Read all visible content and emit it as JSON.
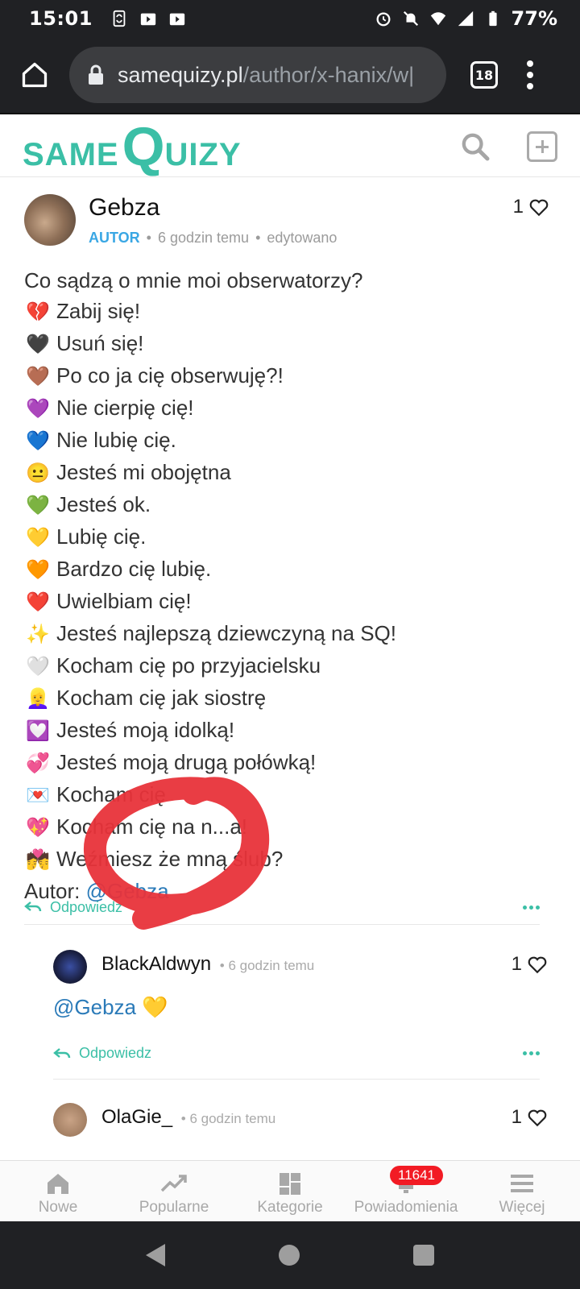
{
  "status_bar": {
    "time": "15:01",
    "battery": "77%"
  },
  "browser": {
    "domain": "samequizy.pl",
    "path": "/author/x-hanix/w|",
    "tab_count": "18"
  },
  "site": {
    "logo_same": "SAME",
    "logo_q": "Q",
    "logo_uizy": "UIZY",
    "accent_color": "#3bbfa6"
  },
  "post": {
    "author": "Gebza",
    "role": "AUTOR",
    "time": "6 godzin temu",
    "edited": "edytowano",
    "likes": "1",
    "lines": [
      {
        "emoji": "",
        "text": "Co sądzą o mnie moi obserwatorzy?"
      },
      {
        "emoji": "💔",
        "text": "Zabij się!"
      },
      {
        "emoji": "🖤",
        "text": "Usuń się!"
      },
      {
        "emoji": "🤎",
        "text": "Po co ja cię obserwuję?!"
      },
      {
        "emoji": "💜",
        "text": "Nie cierpię cię!"
      },
      {
        "emoji": "💙",
        "text": "Nie lubię cię."
      },
      {
        "emoji": "😐",
        "text": "Jesteś mi obojętna"
      },
      {
        "emoji": "💚",
        "text": "Jesteś ok."
      },
      {
        "emoji": "💛",
        "text": "Lubię cię."
      },
      {
        "emoji": "🧡",
        "text": "Bardzo cię lubię."
      },
      {
        "emoji": "❤️",
        "text": "Uwielbiam cię!"
      },
      {
        "emoji": "✨",
        "text": "Jesteś najlepszą dziewczyną na SQ!"
      },
      {
        "emoji": "🤍",
        "text": "Kocham cię po przyjacielsku"
      },
      {
        "emoji": "👱‍♀️",
        "text": "Kocham cię jak siostrę"
      },
      {
        "emoji": "💟",
        "text": "Jesteś moją idolką!"
      },
      {
        "emoji": "💞",
        "text": "Jesteś moją drugą połówką!"
      },
      {
        "emoji": "💌",
        "text": "Kocham cię"
      },
      {
        "emoji": "💖",
        "text": "Kocham cię na n...a!"
      },
      {
        "emoji": "💏",
        "text": "Weźmiesz że mną ślub?"
      }
    ],
    "author_credit_prefix": "Autor: ",
    "author_credit_mention": "@Gebza",
    "reply_label": "Odpowiedz"
  },
  "comments": [
    {
      "name": "BlackAldwyn",
      "time": "6 godzin temu",
      "likes": "1",
      "body": "@Gebza 💛",
      "reply_label": "Odpowiedz"
    },
    {
      "name": "OlaGie_",
      "time": "6 godzin temu",
      "likes": "1"
    }
  ],
  "bottom_nav": [
    {
      "label": "Nowe",
      "icon": "home-icon"
    },
    {
      "label": "Popularne",
      "icon": "trending-icon"
    },
    {
      "label": "Kategorie",
      "icon": "grid-icon"
    },
    {
      "label": "Powiadomienia",
      "icon": "bell-icon",
      "badge": "11641"
    },
    {
      "label": "Więcej",
      "icon": "menu-icon"
    }
  ]
}
